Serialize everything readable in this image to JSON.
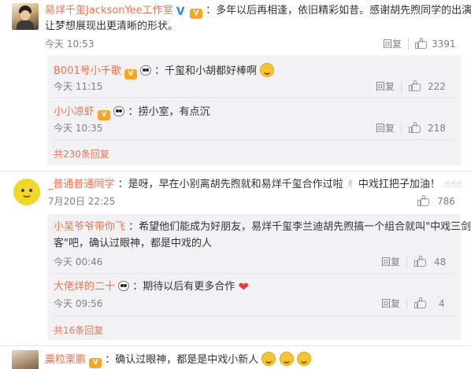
{
  "comments": [
    {
      "user": "易烊千玺JacksonYee工作室",
      "text_line1": "：多年以后再相逢，依旧精彩如昔。感谢胡先煦同学的出演，",
      "text_line2": "让梦想展现出更清晰的形状。",
      "time": "今天 10:53",
      "reply_label": "回复",
      "likes": "3391",
      "replies": [
        {
          "user": "B001号小千歌",
          "text": "：千玺和小胡都好棒啊",
          "time": "今天 11:15",
          "reply_label": "回复",
          "likes": "222"
        },
        {
          "user": "小小凉虾",
          "text": "：捞小室，有点沉",
          "time": "今天 10:35",
          "reply_label": "回复",
          "likes": "218"
        }
      ],
      "more_replies": "共230条回复"
    },
    {
      "user": "_普通普通同学",
      "text": "：是呀，早在小别离胡先煦就和易烊千玺合作过啦",
      "text_after": "中戏扛把子加油！",
      "time": "7月20日 22:25",
      "likes": "786",
      "replies": [
        {
          "user": "小吴爷爷带你飞",
          "text_line1": "：希望他们能成为好朋友，易烊千玺李兰迪胡先煦搞一个组合就叫\"中戏三剑",
          "text_line2": "客\"吧，确认过眼神，都是中戏的人",
          "time": "今天 00:46",
          "reply_label": "回复",
          "likes": "48"
        },
        {
          "user": "大佬烊的二十",
          "text": "：期待以后有更多合作",
          "time": "今天 09:56",
          "reply_label": "回复",
          "likes": "4"
        }
      ],
      "more_replies": "共16条回复"
    },
    {
      "user": "粟粒栗鹏",
      "text": "：确认过眼神，都是是中戏小新人"
    }
  ],
  "badges": {
    "vip": "V",
    "bigv": "V"
  },
  "colors": {
    "name": "#eb7350",
    "text": "#333333",
    "meta": "#808080",
    "reply_bg": "#f2f2f5"
  }
}
